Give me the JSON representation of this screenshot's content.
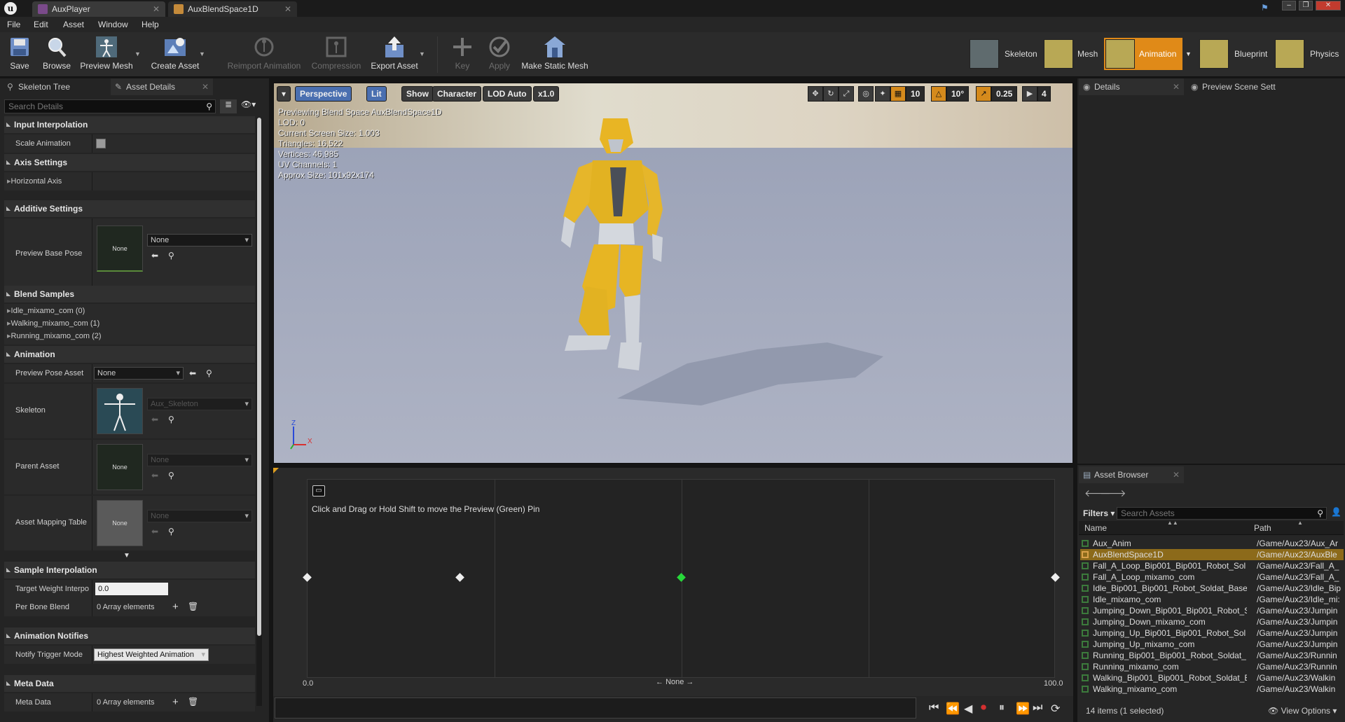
{
  "title_tabs": [
    {
      "label": "AuxPlayer"
    },
    {
      "label": "AuxBlendSpace1D"
    }
  ],
  "menu": [
    "File",
    "Edit",
    "Asset",
    "Window",
    "Help"
  ],
  "toolbar": {
    "save": "Save",
    "browse": "Browse",
    "preview_mesh": "Preview Mesh",
    "create_asset": "Create Asset",
    "reimport": "Reimport Animation",
    "compression": "Compression",
    "export": "Export Asset",
    "key": "Key",
    "apply": "Apply",
    "make_static": "Make Static Mesh"
  },
  "modes": {
    "skeleton": "Skeleton",
    "mesh": "Mesh",
    "animation": "Animation",
    "blueprint": "Blueprint",
    "physics": "Physics",
    "active_color": "#e08a18"
  },
  "left": {
    "tabs": [
      "Skeleton Tree",
      "Asset Details"
    ],
    "search_placeholder": "Search Details",
    "input_interpolation": "Input Interpolation",
    "scale_animation": "Scale Animation",
    "axis_settings": "Axis Settings",
    "horizontal_axis": "Horizontal Axis",
    "additive_settings": "Additive Settings",
    "preview_base_pose": "Preview Base Pose",
    "none": "None",
    "blend_samples": "Blend Samples",
    "samples": [
      "Idle_mixamo_com (0)",
      "Walking_mixamo_com (1)",
      "Running_mixamo_com (2)"
    ],
    "animation": "Animation",
    "preview_pose_asset": "Preview Pose Asset",
    "skeleton": "Skeleton",
    "skeleton_value": "Aux_Skeleton",
    "parent_asset": "Parent Asset",
    "asset_mapping_table": "Asset Mapping Table",
    "sample_interpolation": "Sample Interpolation",
    "target_weight": "Target Weight Interpo",
    "target_weight_value": "0.0",
    "per_bone_blend": "Per Bone Blend",
    "array_elements": "0 Array elements",
    "animation_notifies": "Animation Notifies",
    "notify_trigger_mode": "Notify Trigger Mode",
    "notify_trigger_value": "Highest Weighted Animation",
    "meta_data": "Meta Data",
    "meta_data_row": "Meta Data"
  },
  "viewport": {
    "perspective": "Perspective",
    "lit": "Lit",
    "show": "Show",
    "character": "Character",
    "lod": "LOD Auto",
    "speed": "x1.0",
    "info": [
      "Previewing Blend Space AuxBlendSpace1D",
      "LOD: 0",
      "Current Screen Size: 1.003",
      "Triangles: 16,522",
      "Vertices: 46,985",
      "UV Channels: 1",
      "Approx Size: 101x92x174"
    ],
    "grid_snap": "10",
    "rot_snap": "10°",
    "scale_snap": "0.25",
    "cam_speed": "4",
    "axis_z": "Z",
    "axis_x": "X"
  },
  "blend": {
    "hint": "Click and Drag or Hold Shift to move the Preview (Green) Pin",
    "min": "0.0",
    "max": "100.0",
    "axis_label": "None",
    "preview_pin_fraction": 0.5
  },
  "right": {
    "tabs": [
      "Details",
      "Preview Scene Sett"
    ]
  },
  "asset_browser": {
    "tab": "Asset Browser",
    "filters": "Filters",
    "search_placeholder": "Search Assets",
    "col_name": "Name",
    "col_path": "Path",
    "items": [
      {
        "name": "Aux_Anim",
        "path": "/Game/Aux23/Aux_Ar"
      },
      {
        "name": "AuxBlendSpace1D",
        "path": "/Game/Aux23/AuxBle",
        "selected": true
      },
      {
        "name": "Fall_A_Loop_Bip001_Bip001_Robot_Sol",
        "path": "/Game/Aux23/Fall_A_"
      },
      {
        "name": "Fall_A_Loop_mixamo_com",
        "path": "/Game/Aux23/Fall_A_"
      },
      {
        "name": "Idle_Bip001_Bip001_Robot_Soldat_Base",
        "path": "/Game/Aux23/Idle_Bip"
      },
      {
        "name": "Idle_mixamo_com",
        "path": "/Game/Aux23/Idle_mi:"
      },
      {
        "name": "Jumping_Down_Bip001_Bip001_Robot_S",
        "path": "/Game/Aux23/Jumpin"
      },
      {
        "name": "Jumping_Down_mixamo_com",
        "path": "/Game/Aux23/Jumpin"
      },
      {
        "name": "Jumping_Up_Bip001_Bip001_Robot_Sol",
        "path": "/Game/Aux23/Jumpin"
      },
      {
        "name": "Jumping_Up_mixamo_com",
        "path": "/Game/Aux23/Jumpin"
      },
      {
        "name": "Running_Bip001_Bip001_Robot_Soldat_",
        "path": "/Game/Aux23/Runnin"
      },
      {
        "name": "Running_mixamo_com",
        "path": "/Game/Aux23/Runnin"
      },
      {
        "name": "Walking_Bip001_Bip001_Robot_Soldat_E",
        "path": "/Game/Aux23/Walkin"
      },
      {
        "name": "Walking_mixamo_com",
        "path": "/Game/Aux23/Walkin"
      }
    ],
    "count": "14 items (1 selected)",
    "view_options": "View Options"
  }
}
